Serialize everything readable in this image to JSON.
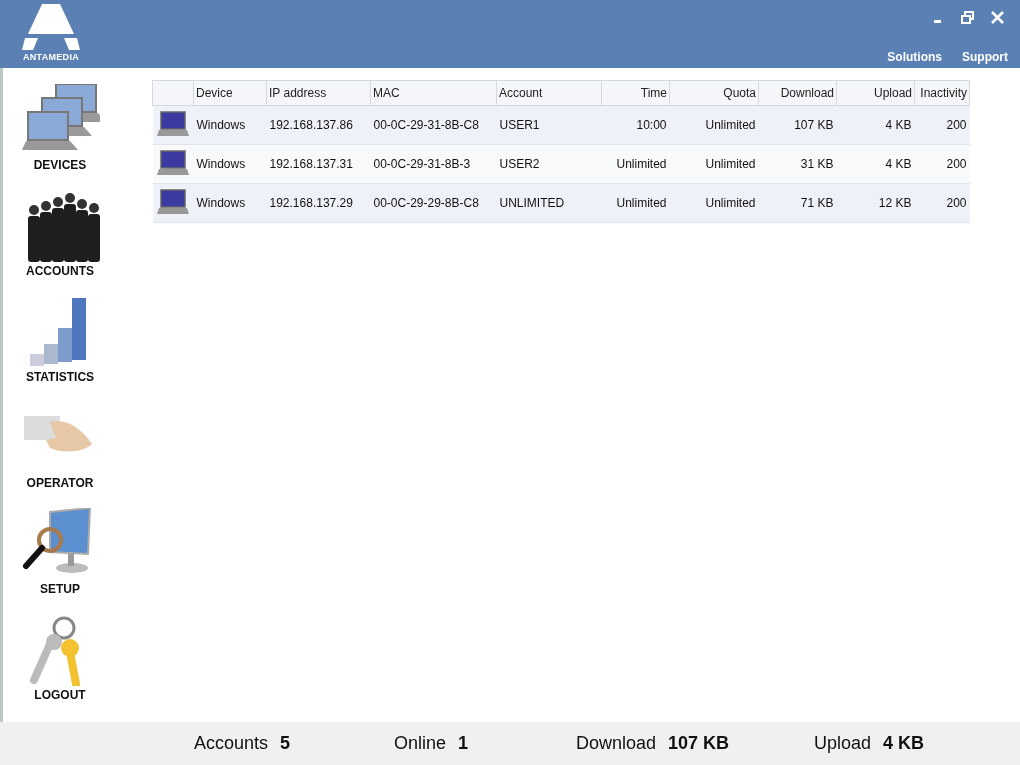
{
  "window": {
    "logo_text": "ANTAMEDIA",
    "controls": [
      {
        "kind": "minimize"
      },
      {
        "kind": "restore"
      },
      {
        "kind": "close"
      }
    ]
  },
  "top_links": [
    "Solutions",
    "Support"
  ],
  "sidebar": {
    "items": [
      {
        "label": "DEVICES",
        "kind": "devices"
      },
      {
        "label": "ACCOUNTS",
        "kind": "accounts"
      },
      {
        "label": "STATISTICS",
        "kind": "statistics"
      },
      {
        "label": "OPERATOR",
        "kind": "operator"
      },
      {
        "label": "SETUP",
        "kind": "setup"
      },
      {
        "label": "LOGOUT",
        "kind": "logout"
      }
    ]
  },
  "table": {
    "columns": [
      "Device",
      "IP address",
      "MAC",
      "Account",
      "Time",
      "Quota",
      "Download",
      "Upload",
      "Inactivity"
    ],
    "rows": [
      {
        "kind": "laptop",
        "cells": [
          "Windows",
          "192.168.137.86",
          "00-0C-29-31-8B-C8",
          "USER1",
          "10:00",
          "Unlimited",
          "107 KB",
          "4 KB",
          "200"
        ]
      },
      {
        "kind": "laptop",
        "cells": [
          "Windows",
          "192.168.137.31",
          "00-0C-29-31-8B-3",
          "USER2",
          "Unlimited",
          "Unlimited",
          "31 KB",
          "4 KB",
          "200"
        ]
      },
      {
        "kind": "laptop",
        "cells": [
          "Windows",
          "192.168.137.29",
          "00-0C-29-29-8B-C8",
          "UNLIMITED",
          "Unlimited",
          "Unlimited",
          "71 KB",
          "12 KB",
          "200"
        ]
      }
    ]
  },
  "status_bar": [
    {
      "label": "Accounts",
      "value": "5"
    },
    {
      "label": "Online",
      "value": "1"
    },
    {
      "label": "Download",
      "value": "107 KB"
    },
    {
      "label": "Upload",
      "value": "4 KB"
    }
  ]
}
